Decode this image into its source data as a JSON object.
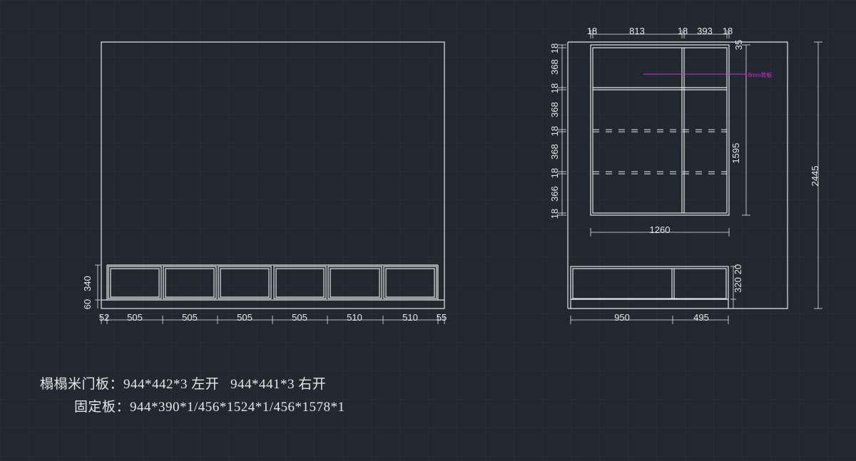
{
  "colors": {
    "background": "#212830",
    "grid": "#2b3440",
    "line": "#e6e6e6",
    "accent": "#d42ad4"
  },
  "left_view": {
    "bottom_widths": [
      "52",
      "505",
      "505",
      "505",
      "505",
      "510",
      "510",
      "55"
    ],
    "heights": [
      "60",
      "340"
    ]
  },
  "right_view": {
    "top_widths": [
      "18",
      "813",
      "18",
      "393",
      "18"
    ],
    "top_right": "35",
    "left_heights": [
      "18",
      "368",
      "18",
      "368",
      "18",
      "368",
      "18",
      "366",
      "18"
    ],
    "inner_height": "1595",
    "total_height": "2445",
    "inner_width": "1260",
    "bottom_widths": [
      "950",
      "495"
    ],
    "cabinet_heights": [
      "320",
      "20"
    ],
    "back_panel_note": "18mm背板"
  },
  "notes": {
    "line1": "榻榻米门板：944*442*3 左开   944*441*3 右开",
    "line2": "固定板：944*390*1/456*1524*1/456*1578*1"
  }
}
